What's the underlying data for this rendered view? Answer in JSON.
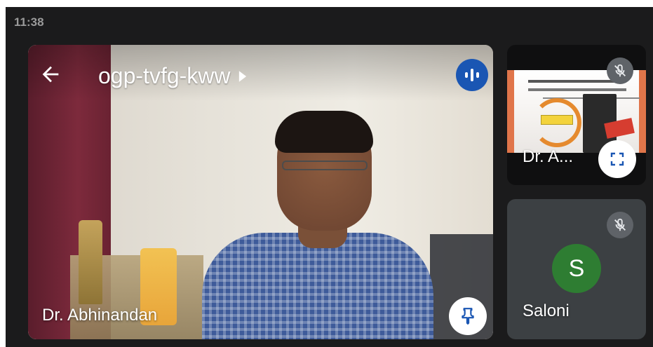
{
  "status_bar": {
    "time": "11:38"
  },
  "main_tile": {
    "meeting_code": "ogp-tvfg-kww",
    "participant_name": "Dr. Abhinandan",
    "icons": {
      "back": "arrow-left-icon",
      "expand": "caret-right-icon",
      "audio": "audio-level-icon",
      "pin": "pin-icon"
    }
  },
  "side_tiles": [
    {
      "name": "Dr. A...",
      "muted": true,
      "content": "screen share",
      "icons": [
        "mic-off-icon",
        "fullscreen-icon"
      ]
    },
    {
      "name": "Saloni",
      "muted": true,
      "avatar_letter": "S",
      "avatar_color": "#2e7d32",
      "icons": [
        "mic-off-icon"
      ]
    }
  ],
  "colors": {
    "background": "#1b1b1c",
    "accent": "#1a56b3",
    "tile_gray": "#3c4043"
  }
}
